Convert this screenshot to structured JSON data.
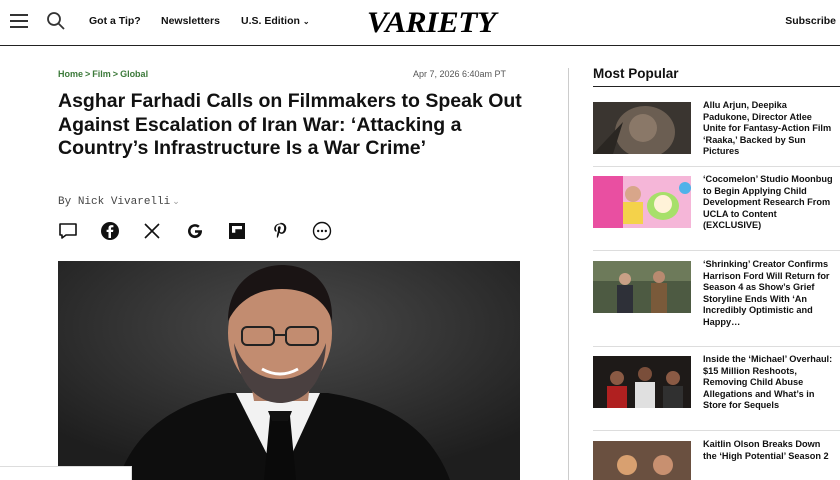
{
  "header": {
    "nav_links": [
      "Got a Tip?",
      "Newsletters",
      "U.S. Edition"
    ],
    "logo_text": "VARIETY",
    "subscribe": "Subscribe"
  },
  "article": {
    "breadcrumb": [
      "Home",
      "Film",
      "Global"
    ],
    "breadcrumb_sep": ">",
    "date": "Apr 7, 2026 6:40am PT",
    "headline": "Asghar Farhadi Calls on Filmmakers to Speak Out Against Escalation of Iran War: ‘Attacking a Country’s Infrastructure Is a War Crime’",
    "byline_prefix": "By",
    "author": "Nick Vivarelli",
    "share_icons": [
      "comment-icon",
      "facebook-icon",
      "x-icon",
      "google-icon",
      "flipboard-icon",
      "pinterest-icon",
      "more-icon"
    ]
  },
  "most_popular": {
    "title": "Most Popular",
    "items": [
      {
        "title": "Allu Arjun, Deepika Padukone, Director Atlee Unite for Fantasy-Action Film ‘Raaka,’ Backed by Sun Pictures"
      },
      {
        "title": "‘Cocomelon’ Studio Moonbug to Begin Applying Child Development Research From UCLA to Content (EXCLUSIVE)"
      },
      {
        "title": "‘Shrinking’ Creator Confirms Harrison Ford Will Return for Season 4 as Show’s Grief Storyline Ends With ‘An Incredibly Optimistic and Happy…"
      },
      {
        "title": "Inside the ‘Michael’ Overhaul: $15 Million Reshoots, Removing Child Abuse Allegations and What’s in Store for Sequels"
      },
      {
        "title": "Kaitlin Olson Breaks Down the ‘High Potential’ Season 2"
      }
    ]
  },
  "colors": {
    "breadcrumb": "#3c7a3a",
    "text": "#111111",
    "rule": "#222222"
  }
}
